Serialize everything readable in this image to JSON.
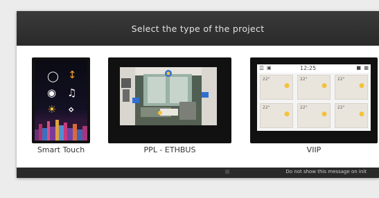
{
  "dialog": {
    "title": "Select the type of the project",
    "footer_checkbox_label": "Do not show this message on init"
  },
  "options": [
    {
      "label": "Smart Touch",
      "icon": "smart-touch-panel-image"
    },
    {
      "label": "PPL - ETHBUS",
      "icon": "ppl-panel-image"
    },
    {
      "label": "VIIP",
      "icon": "viip-panel-image"
    }
  ],
  "viip_screen": {
    "time": "12:25",
    "rooms": [
      "22°",
      "22°",
      "22°",
      "22°",
      "22°",
      "22°"
    ]
  },
  "colors": {
    "dialog_bg": "#2c2c2c",
    "content_bg": "#ffffff",
    "title_text": "#e2e2e2"
  }
}
